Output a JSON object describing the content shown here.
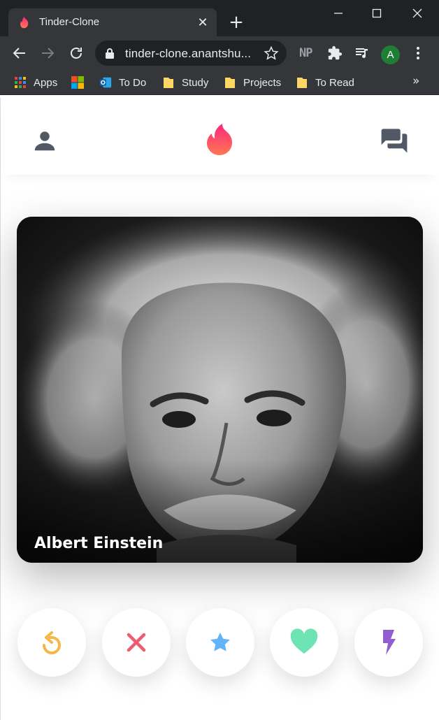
{
  "browser": {
    "tab_title": "Tinder-Clone",
    "tab_close": "✕",
    "new_tab": "+",
    "url": "tinder-clone.anantshu...",
    "extension_np": "NP",
    "profile_initial": "A",
    "bookmarks": [
      {
        "label": "Apps",
        "icon": "apps-grid-icon"
      },
      {
        "label": "",
        "icon": "microsoft-logo-icon"
      },
      {
        "label": "To Do",
        "icon": "outlook-icon"
      },
      {
        "label": "Study",
        "icon": "folder-icon"
      },
      {
        "label": "Projects",
        "icon": "folder-icon"
      },
      {
        "label": "To Read",
        "icon": "folder-icon"
      }
    ],
    "bookmarks_more": "»"
  },
  "app": {
    "header": {
      "left_icon": "person-icon",
      "center_icon": "tinder-flame-logo",
      "right_icon": "chat-icon"
    },
    "card": {
      "name": "Albert Einstein",
      "photo": "portrait-photo"
    },
    "actions": [
      {
        "name": "rewind",
        "icon": "replay-icon",
        "color": "#f5b748"
      },
      {
        "name": "nope",
        "icon": "close-icon",
        "color": "#ec5e6f"
      },
      {
        "name": "super-like",
        "icon": "star-icon",
        "color": "#62b4f9"
      },
      {
        "name": "like",
        "icon": "heart-icon",
        "color": "#6ee3b4"
      },
      {
        "name": "boost",
        "icon": "bolt-icon",
        "color": "#915dd1"
      }
    ]
  },
  "colors": {
    "chrome_dark": "#202124",
    "chrome_toolbar": "#35363a",
    "header_icons": "#505965",
    "brand_gradient_start": "#fd267d",
    "brand_gradient_end": "#ff7854"
  }
}
